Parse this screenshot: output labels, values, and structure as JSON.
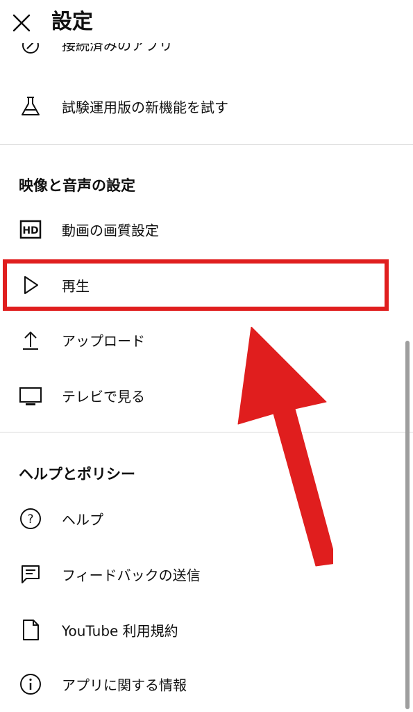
{
  "header": {
    "title": "設定",
    "close_icon": "close-icon"
  },
  "sections": {
    "general_tail": [
      {
        "label": "接続済みのアプリ",
        "icon": "connected-apps-icon"
      },
      {
        "label": "試験運用版の新機能を試す",
        "icon": "flask-icon"
      }
    ],
    "video_audio": {
      "title": "映像と音声の設定",
      "items": [
        {
          "label": "動画の画質設定",
          "icon": "hd-icon"
        },
        {
          "label": "再生",
          "icon": "play-icon"
        },
        {
          "label": "アップロード",
          "icon": "upload-icon"
        },
        {
          "label": "テレビで見る",
          "icon": "tv-icon"
        }
      ]
    },
    "help_policy": {
      "title": "ヘルプとポリシー",
      "items": [
        {
          "label": "ヘルプ",
          "icon": "help-icon"
        },
        {
          "label": "フィードバックの送信",
          "icon": "feedback-icon"
        },
        {
          "label": "YouTube 利用規約",
          "icon": "document-icon"
        },
        {
          "label": "アプリに関する情報",
          "icon": "info-icon"
        }
      ]
    }
  },
  "annotation": {
    "highlight_color": "#e01e1e",
    "arrow_color": "#e01e1e"
  }
}
